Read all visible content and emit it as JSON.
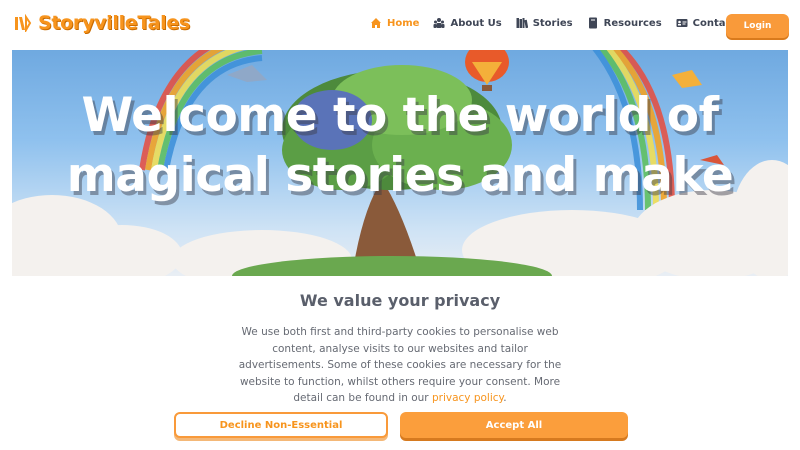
{
  "brand": {
    "name": "StoryvilleTales",
    "color": "#f7941d"
  },
  "nav": {
    "items": [
      {
        "label": "Home",
        "icon": "home-icon",
        "active": true
      },
      {
        "label": "About Us",
        "icon": "people-icon",
        "active": false
      },
      {
        "label": "Stories",
        "icon": "books-icon",
        "active": false
      },
      {
        "label": "Resources",
        "icon": "book-icon",
        "active": false
      },
      {
        "label": "Contact Us",
        "icon": "contact-card-icon",
        "active": false
      }
    ],
    "login_label": "Login"
  },
  "hero": {
    "title": "Welcome to the world of magical stories and make"
  },
  "consent": {
    "title": "We value your privacy",
    "body": "We use both first and third-party cookies to personalise web content, analyse visits to our websites and tailor advertisements. Some of these cookies are necessary for the website to function, whilst others require your consent. More detail can be found in our ",
    "link_label": "privacy policy",
    "body_end": ".",
    "decline_label": "Decline Non-Essential",
    "accept_label": "Accept All"
  },
  "colors": {
    "accent": "#f99a3a",
    "text": "#3f4656"
  }
}
